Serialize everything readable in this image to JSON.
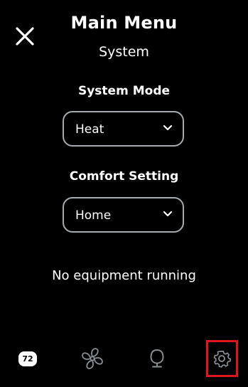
{
  "header": {
    "title": "Main Menu",
    "subtitle": "System"
  },
  "system_mode": {
    "label": "System Mode",
    "selected": "Heat"
  },
  "comfort_setting": {
    "label": "Comfort Setting",
    "selected": "Home"
  },
  "status": {
    "text": "No equipment running"
  },
  "bottom_nav": {
    "temperature": "72",
    "icons": [
      "temperature-icon",
      "fan-icon",
      "sensor-icon",
      "gear-icon"
    ],
    "highlight_color": "#e0161e"
  },
  "colors": {
    "background": "#000000",
    "text": "#ffffff",
    "select_border": "#a6abb0",
    "icon_muted": "#8a8f94"
  }
}
